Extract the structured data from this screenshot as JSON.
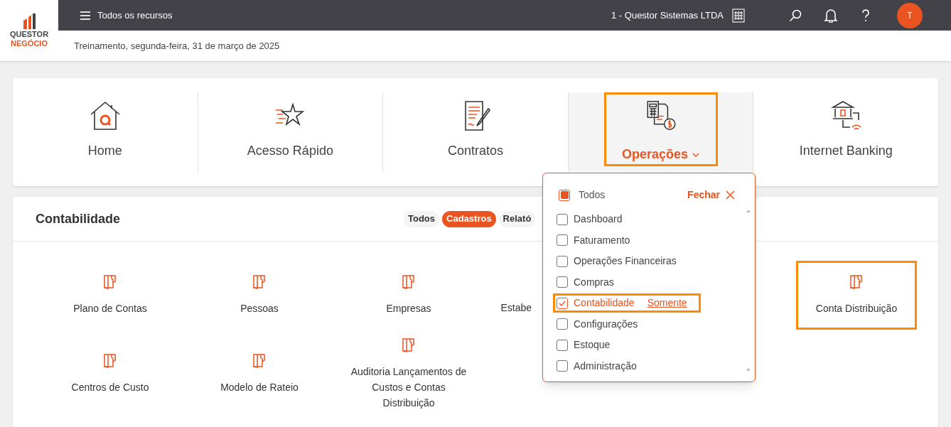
{
  "header": {
    "logo_top": "QUESTOR",
    "logo_bottom": "NEGÓCIO",
    "menu_label": "Todos os recursos",
    "company": "1 - Questor Sistemas LTDA",
    "avatar": "T",
    "subtitle": "Treinamento, segunda-feira, 31 de março de 2025"
  },
  "nav": [
    {
      "label": "Home",
      "selected": false,
      "highlighted": false
    },
    {
      "label": "Acesso Rápido",
      "selected": false,
      "highlighted": false
    },
    {
      "label": "Contratos",
      "selected": false,
      "highlighted": false
    },
    {
      "label": "Operações",
      "selected": true,
      "highlighted": true
    },
    {
      "label": "Internet Banking",
      "selected": false,
      "highlighted": false
    }
  ],
  "section": {
    "title": "Contabilidade",
    "tabs": [
      {
        "label": "Todos",
        "selected": false
      },
      {
        "label": "Cadastros",
        "selected": true
      },
      {
        "label": "Relató",
        "selected": false
      }
    ],
    "items": [
      {
        "label": "Plano de Contas",
        "highlighted": false
      },
      {
        "label": "Pessoas",
        "highlighted": false
      },
      {
        "label": "Empresas",
        "highlighted": false
      },
      {
        "label": "Estabe",
        "kind": "partial"
      },
      {
        "label": "Conta Distribuição",
        "highlighted": true
      },
      {
        "label": "Centros de Custo",
        "highlighted": false
      },
      {
        "label": "Modelo de Rateio",
        "highlighted": false
      },
      {
        "label": "Auditoria Lançamentos de Custos e Contas Distribuição",
        "highlighted": false
      }
    ]
  },
  "dropdown": {
    "all": {
      "label": "Todos",
      "indeterminate": true
    },
    "close": "Fechar",
    "options": [
      {
        "label": "Dashboard",
        "checked": false,
        "highlighted": false
      },
      {
        "label": "Faturamento",
        "checked": false,
        "highlighted": false
      },
      {
        "label": "Operações Financeiras",
        "checked": false,
        "highlighted": false
      },
      {
        "label": "Compras",
        "checked": false,
        "highlighted": false
      },
      {
        "label": "Contabilidade",
        "checked": true,
        "highlighted": true,
        "action": "Somente"
      },
      {
        "label": "Configurações",
        "checked": false,
        "highlighted": false
      },
      {
        "label": "Estoque",
        "checked": false,
        "highlighted": false
      },
      {
        "label": "Administração",
        "checked": false,
        "highlighted": false
      }
    ]
  }
}
